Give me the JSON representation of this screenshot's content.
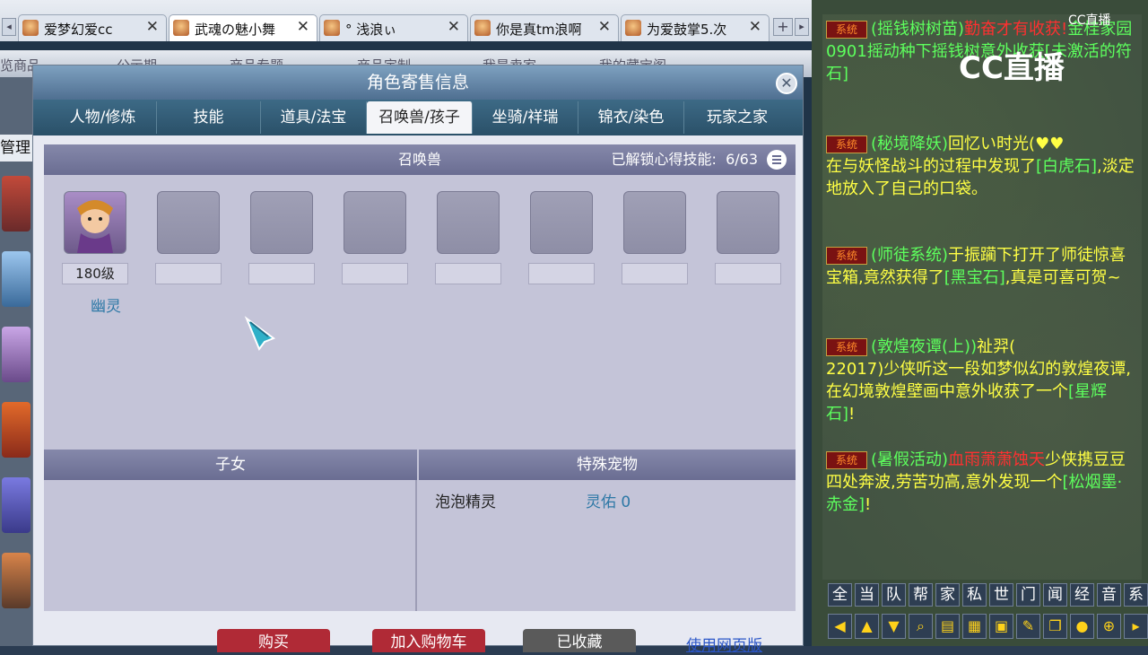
{
  "browser_tabs": [
    {
      "title": "爱梦幻爱cc",
      "active": false
    },
    {
      "title": "武魂の魅小舞",
      "active": true
    },
    {
      "title": "°  浅浪ぃ",
      "active": false
    },
    {
      "title": "你是真tm浪啊",
      "active": false
    },
    {
      "title": "为爱鼓掌5.次",
      "active": false
    }
  ],
  "tab_close_glyph": "✕",
  "new_tab_glyph": "+",
  "bg_tabs": [
    "览商品",
    "公示期",
    "商品专题",
    "商品定制",
    "我是卖家",
    "我的藏宝阁"
  ],
  "left_label": "管理",
  "dialog": {
    "title": "角色寄售信息",
    "close_glyph": "✕",
    "nav_tabs": [
      "人物/修炼",
      "技能",
      "道具/法宝",
      "召唤兽/孩子",
      "坐骑/祥瑞",
      "锦衣/染色",
      "玩家之家"
    ],
    "active_tab": "召唤兽/孩子",
    "pet_section": {
      "title": "召唤兽",
      "unlock_label": "已解锁心得技能:",
      "unlock_value": "6/63",
      "pets": [
        {
          "level": "180级",
          "name": "幽灵"
        }
      ],
      "slot_count": 8
    },
    "children_section": {
      "title": "子女"
    },
    "special_section": {
      "title": "特殊宠物",
      "item_name": "泡泡精灵",
      "item_value": "灵佑 0"
    },
    "actions": [
      {
        "label": "购买",
        "color": "#b02a36"
      },
      {
        "label": "加入购物车",
        "color": "#b02a36"
      },
      {
        "label": "已收藏",
        "color": "#5a5a5a"
      }
    ],
    "web_link": "使用网页版"
  },
  "chat": {
    "cc_logo": "CC直播",
    "cc_mark": "CC直播",
    "messages": [
      {
        "tag": "系统",
        "segments": [
          [
            "(摇钱树树苗)",
            "g"
          ],
          [
            "勤奋才有收获!",
            "r"
          ],
          [
            "金桂家园0901摇动种下摇钱树意外收获[未激活的符石]",
            "g"
          ]
        ]
      },
      {
        "tag": "系统",
        "segments": [
          [
            "(秘境降妖)",
            "g"
          ],
          [
            "回忆い时光(",
            "y"
          ],
          [
            "在与妖怪战斗的过程中发现了",
            "y"
          ],
          [
            "[白虎石]",
            "g"
          ],
          [
            ",淡定地放入了自己的口袋。",
            "y"
          ]
        ]
      },
      {
        "tag": "系统",
        "segments": [
          [
            "(师徒系统)",
            "g"
          ],
          [
            "于振躏下打开了师徒惊喜宝箱,竟然获得了",
            "y"
          ],
          [
            "[黑宝石]",
            "g"
          ],
          [
            ",真是可喜可贺~",
            "y"
          ]
        ]
      },
      {
        "tag": "系统",
        "segments": [
          [
            "(敦煌夜谭(上))",
            "g"
          ],
          [
            "祉羿(",
            "y"
          ],
          [
            "22017)少侠听这一段如梦似幻的敦煌夜谭,在幻境敦煌壁画中意外收获了一个",
            "y"
          ],
          [
            "[星辉石]",
            "g"
          ],
          [
            "!",
            "y"
          ]
        ]
      },
      {
        "tag": "系统",
        "segments": [
          [
            "(暑假活动)",
            "g"
          ],
          [
            "血雨萧萧蚀天",
            "r"
          ],
          [
            "少侠携豆豆四处奔波,劳苦功高,意外发现一个",
            "y"
          ],
          [
            "[松烟墨·赤金]",
            "g"
          ],
          [
            "!",
            "y"
          ]
        ]
      }
    ],
    "channel_buttons": [
      "全",
      "当",
      "队",
      "帮",
      "家",
      "私",
      "世",
      "门",
      "闻",
      "经",
      "音",
      "系"
    ],
    "tool_icons": [
      "left-arrow-icon",
      "up-arrow-icon",
      "down-arrow-icon",
      "search-icon",
      "document-icon",
      "grid-icon",
      "lock-icon",
      "brush-icon",
      "copy-icon",
      "chat-bubble-icon",
      "add-icon",
      "more-icon"
    ]
  }
}
